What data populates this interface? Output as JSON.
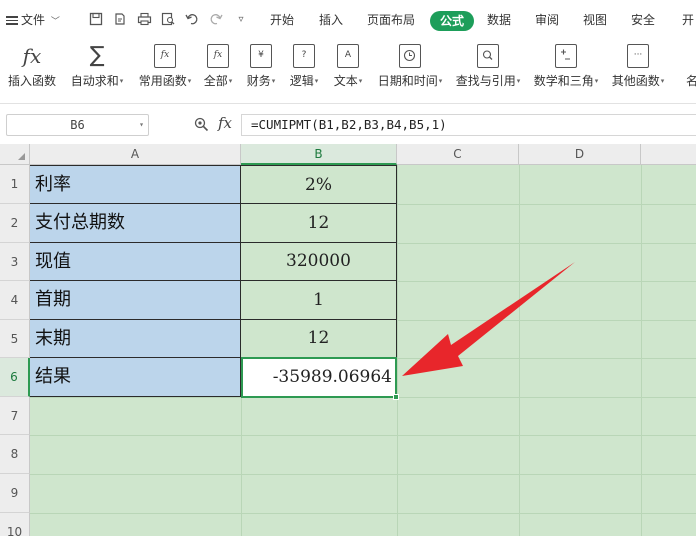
{
  "menubar": {
    "file_label": "文件",
    "file_caret": "﹀",
    "tabs": [
      "开始",
      "插入",
      "页面布局",
      "公式",
      "数据",
      "审阅",
      "视图",
      "安全",
      "开"
    ],
    "active_tab": "公式"
  },
  "ribbon": {
    "insert_function": {
      "label": "插入函数"
    },
    "autosum": {
      "label": "自动求和"
    },
    "common_functions": {
      "label": "常用函数"
    },
    "all": {
      "label": "全部"
    },
    "finance": {
      "label": "财务",
      "icon_glyph": "¥"
    },
    "logic": {
      "label": "逻辑",
      "icon_glyph": "?"
    },
    "text": {
      "label": "文本",
      "icon_glyph": "A"
    },
    "datetime": {
      "label": "日期和时间"
    },
    "lookup": {
      "label": "查找与引用"
    },
    "math": {
      "label": "数学和三角"
    },
    "other": {
      "label": "其他函数"
    },
    "cut_off_label": "名",
    "caret": "▾",
    "fx_glyph": "fx",
    "sum_glyph": "∑"
  },
  "formula_bar": {
    "name_box": "B6",
    "fx_label": "fx",
    "formula": "=CUMIPMT(B1,B2,B3,B4,B5,1)"
  },
  "grid": {
    "columns": [
      "A",
      "B",
      "C",
      "D"
    ],
    "rows": [
      "1",
      "2",
      "3",
      "4",
      "5",
      "6",
      "7",
      "8",
      "9",
      "10"
    ],
    "active_cell": "B6",
    "table": [
      {
        "label": "利率",
        "value": "2%"
      },
      {
        "label": "支付总期数",
        "value": "12"
      },
      {
        "label": "现值",
        "value": "320000"
      },
      {
        "label": "首期",
        "value": "1"
      },
      {
        "label": "末期",
        "value": "12"
      },
      {
        "label": "结果",
        "value": "-35989.06964"
      }
    ]
  },
  "colors": {
    "accent_green": "#1d9e5a",
    "label_fill": "#bcd5eb",
    "sheet_fill": "#cfe6cd",
    "arrow_red": "#e8262b"
  }
}
